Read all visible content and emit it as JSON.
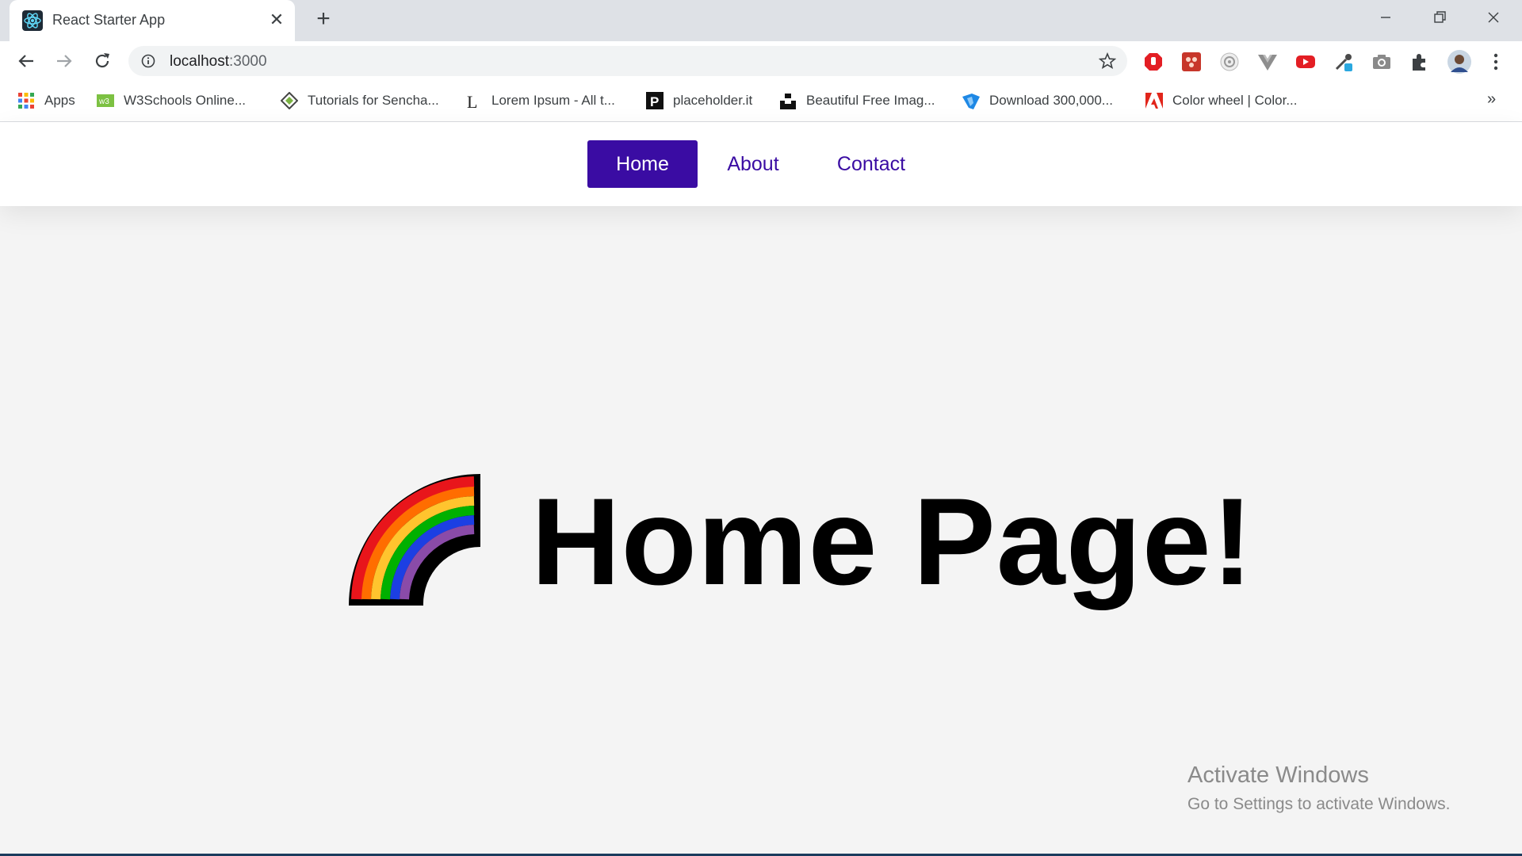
{
  "browser": {
    "tab_title": "React Starter App",
    "address": "localhost",
    "address_port": ":3000",
    "tab_close_glyph": "✕",
    "new_tab_glyph": "+",
    "bookmarks": [
      {
        "label": "Apps",
        "icon": "apps-grid-icon"
      },
      {
        "label": "W3Schools Online...",
        "icon": "w3schools-icon"
      },
      {
        "label": "Tutorials for Sencha...",
        "icon": "sencha-icon"
      },
      {
        "label": "Lorem Ipsum - All t...",
        "icon": "lorem-ipsum-icon"
      },
      {
        "label": "placeholder.it",
        "icon": "placeholder-icon"
      },
      {
        "label": "Beautiful Free Imag...",
        "icon": "unsplash-icon"
      },
      {
        "label": "Download 300,000...",
        "icon": "download-icon"
      },
      {
        "label": "Color wheel | Color...",
        "icon": "adobe-icon"
      }
    ],
    "bookmarks_overflow": "»"
  },
  "nav": {
    "home": "Home",
    "about": "About",
    "contact": "Contact"
  },
  "hero": {
    "title": "Home Page!"
  },
  "watermark": {
    "line1": "Activate Windows",
    "line2": "Go to Settings to activate Windows."
  },
  "colors": {
    "accent": "#3a0ca3",
    "page_bg": "#f4f4f4"
  }
}
